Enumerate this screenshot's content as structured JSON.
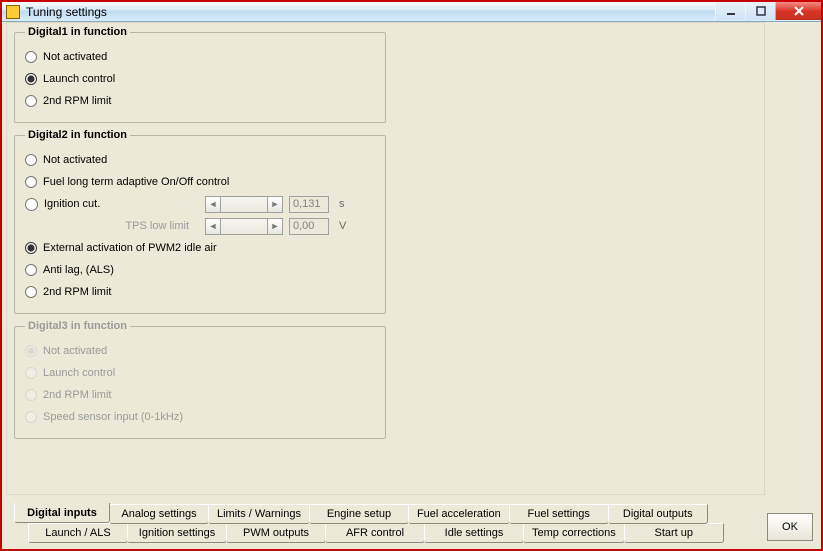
{
  "window": {
    "title": "Tuning settings"
  },
  "groups": {
    "d1": {
      "legend": "Digital1 in function",
      "opt_not_activated": "Not activated",
      "opt_launch_control": "Launch control",
      "opt_2nd_rpm": "2nd RPM limit"
    },
    "d2": {
      "legend": "Digital2 in function",
      "opt_not_activated": "Not activated",
      "opt_fuel_adaptive": "Fuel long term adaptive On/Off control",
      "opt_ignition_cut": "Ignition cut.",
      "ignition_cut_value": "0,131",
      "ignition_cut_unit": "s",
      "tps_label": "TPS low limit",
      "tps_value": "0,00",
      "tps_unit": "V",
      "opt_ext_pwm2": "External activation of PWM2 idle air",
      "opt_antilag": "Anti lag, (ALS)",
      "opt_2nd_rpm": "2nd RPM limit"
    },
    "d3": {
      "legend": "Digital3 in function",
      "opt_not_activated": "Not activated",
      "opt_launch_control": "Launch control",
      "opt_2nd_rpm": "2nd RPM limit",
      "opt_speed_sensor": "Speed sensor input (0-1kHz)"
    }
  },
  "tabs": {
    "row1": {
      "digital_inputs": "Digital inputs",
      "analog_settings": "Analog settings",
      "limits_warnings": "Limits / Warnings",
      "engine_setup": "Engine setup",
      "fuel_acceleration": "Fuel acceleration",
      "fuel_settings": "Fuel settings",
      "digital_outputs": "Digital outputs"
    },
    "row2": {
      "launch_als": "Launch / ALS",
      "ignition_settings": "Ignition settings",
      "pwm_outputs": "PWM outputs",
      "afr_control": "AFR control",
      "idle_settings": "Idle settings",
      "temp_corrections": "Temp corrections",
      "start_up": "Start up"
    }
  },
  "buttons": {
    "ok": "OK"
  }
}
